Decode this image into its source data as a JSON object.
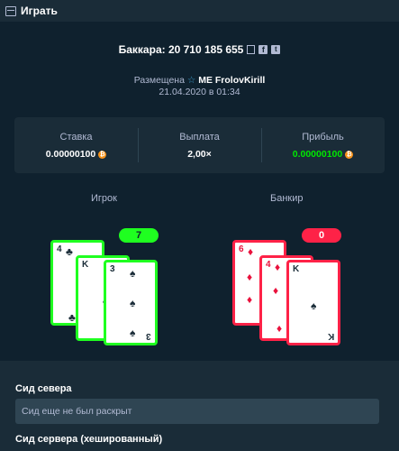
{
  "topbar": {
    "title": "Играть"
  },
  "game": {
    "title": "Баккара: 20 710 185 655",
    "placed_label": "Размещена",
    "user": "ME FrolovKirill",
    "date": "21.04.2020 в 01:34"
  },
  "stats": [
    {
      "label": "Ставка",
      "value": "0.00000100"
    },
    {
      "label": "Выплата",
      "value": "2,00×"
    },
    {
      "label": "Прибыль",
      "value": "0.00000100"
    }
  ],
  "player": {
    "label": "Игрок",
    "score": "7",
    "cards": [
      {
        "rank": "4",
        "suit": "♣"
      },
      {
        "rank": "K",
        "suit": "♣"
      },
      {
        "rank": "3",
        "suit": "♠"
      }
    ]
  },
  "banker": {
    "label": "Банкир",
    "score": "0",
    "cards": [
      {
        "rank": "6",
        "suit": "♦"
      },
      {
        "rank": "4",
        "suit": "♦"
      },
      {
        "rank": "K",
        "suit": "♠"
      }
    ]
  },
  "seeds": {
    "server_seed_label": "Сид севера",
    "server_seed_value": "Сид еще не был раскрыт",
    "server_seed_hashed_label": "Сид сервера (хешированный)"
  },
  "colors": {
    "win": "#1fff20",
    "lose": "#fe2247",
    "bg": "#1a2c38",
    "panel": "#0f212e"
  }
}
